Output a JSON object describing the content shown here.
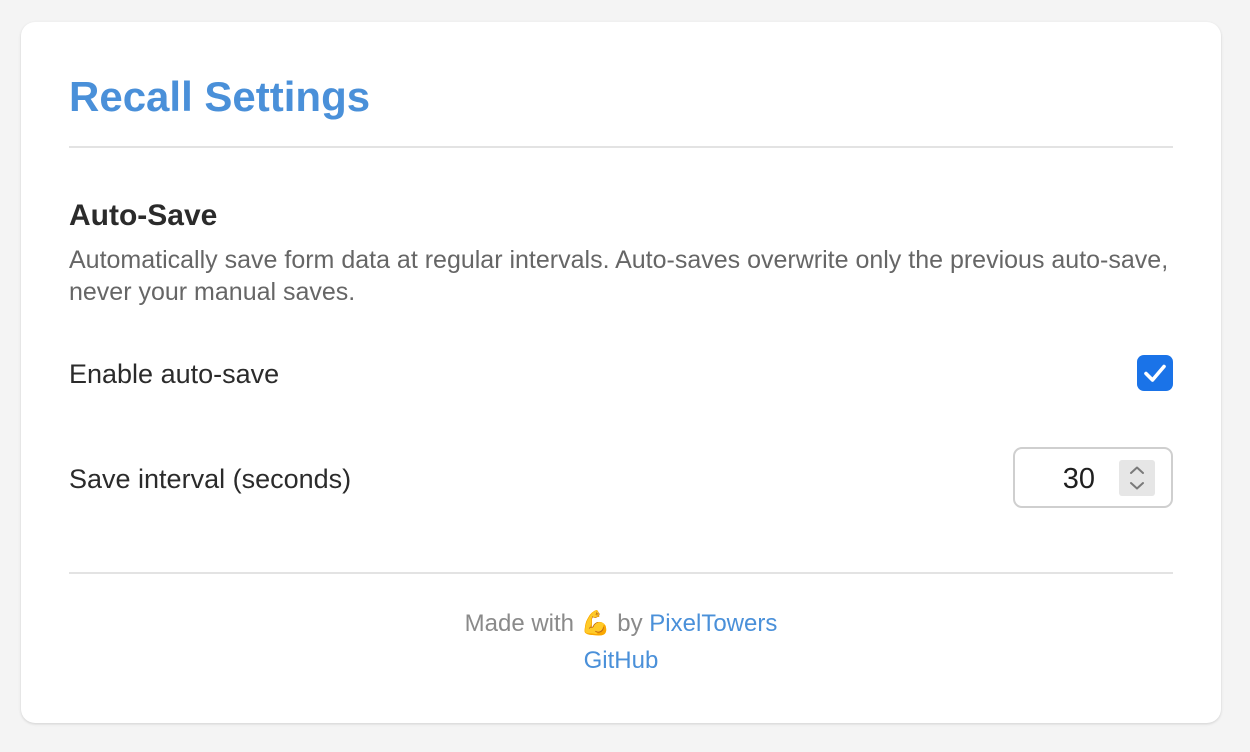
{
  "header": {
    "title": "Recall Settings"
  },
  "auto_save": {
    "heading": "Auto-Save",
    "description": "Automatically save form data at regular intervals. Auto-saves overwrite only the previous auto-save, never your manual saves.",
    "enable_label": "Enable auto-save",
    "enabled": true,
    "interval_label": "Save interval (seconds)",
    "interval_value": "30"
  },
  "footer": {
    "made_with": "Made with",
    "emoji": "💪",
    "by": "by",
    "author_link": "PixelTowers",
    "github_link": "GitHub"
  },
  "colors": {
    "accent": "#4a90d9",
    "checkbox": "#1a73e8",
    "background": "#f4f4f4",
    "card": "#ffffff"
  }
}
